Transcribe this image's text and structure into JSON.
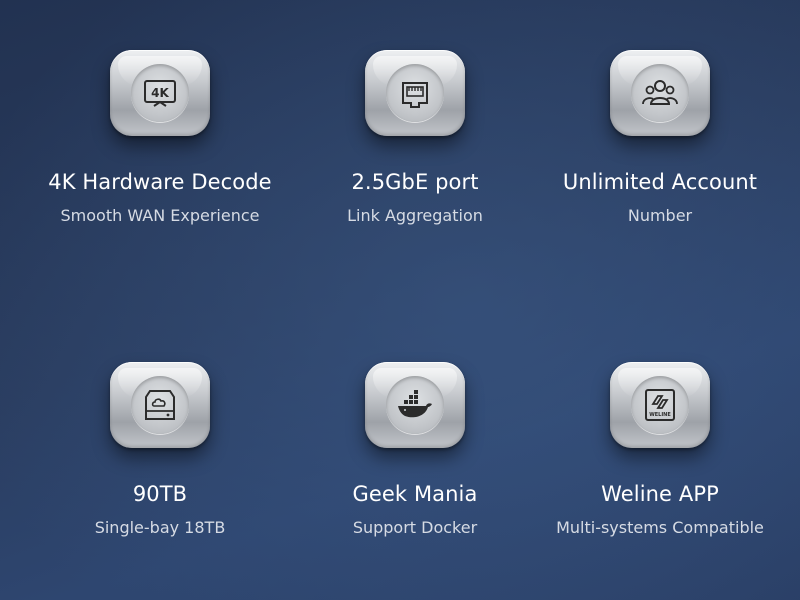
{
  "features": [
    {
      "icon": "4k-icon",
      "icon_text": "4K",
      "title": "4K Hardware Decode",
      "subtitle": "Smooth WAN Experience"
    },
    {
      "icon": "ethernet-port-icon",
      "title": "2.5GbE port",
      "subtitle": "Link Aggregation"
    },
    {
      "icon": "users-group-icon",
      "title": "Unlimited Account",
      "subtitle": "Number"
    },
    {
      "icon": "cloud-drive-icon",
      "title": "90TB",
      "subtitle": "Single-bay 18TB"
    },
    {
      "icon": "docker-whale-icon",
      "title": "Geek Mania",
      "subtitle": "Support Docker"
    },
    {
      "icon": "weline-logo-icon",
      "icon_text": "WELINE",
      "title": "Weline APP",
      "subtitle": "Multi-systems Compatible"
    }
  ],
  "colors": {
    "background": "#2a3d60",
    "title_text": "#ffffff",
    "subtitle_text": "#d6dbe4",
    "icon_stroke": "#2b2b2b"
  }
}
